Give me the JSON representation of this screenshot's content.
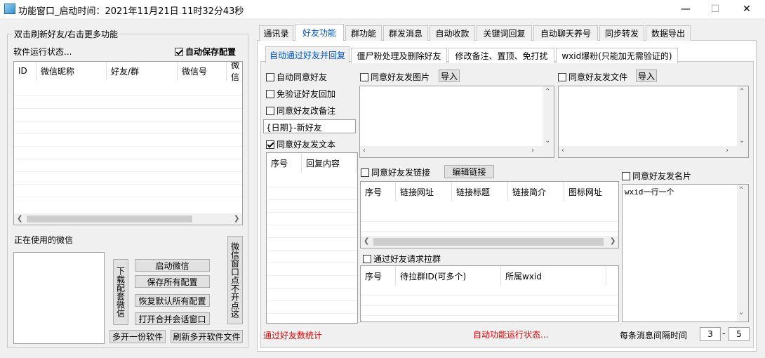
{
  "window": {
    "title": "功能窗口_启动时间：2021年11月21日 11时32分43秒",
    "min": "—",
    "max": "☐",
    "close": "✕"
  },
  "left": {
    "group_title": "双击刷新好友/右击更多功能",
    "status": "软件运行状态...",
    "auto_save": "自动保存配置",
    "columns": [
      "ID",
      "微信昵称",
      "好友/群",
      "微信号",
      "微信"
    ],
    "wechat_in_use": "正在使用的微信",
    "btn_download": "下载配套微信",
    "btn_start": "启动微信",
    "btn_save_all": "保存所有配置",
    "btn_restore": "恢复默认所有配置",
    "btn_open_merge": "打开合并会话窗口",
    "btn_window_no": "微信窗口点不开点这",
    "btn_multi": "多开一份软件",
    "btn_refresh_multi": "刷新多开软件文件"
  },
  "tabs": [
    "通讯录",
    "好友功能",
    "群功能",
    "群发消息",
    "自动收款",
    "关键词回复",
    "自动聊天养号",
    "同步转发",
    "数据导出"
  ],
  "subtabs": [
    "自动通过好友并回复",
    "僵尸粉处理及删除好友",
    "修改备注、置顶、免打扰",
    "wxid爆粉(只能加无需验证的)"
  ],
  "friend": {
    "auto_accept": "自动同意好友",
    "no_verify": "免验证好友回加",
    "change_remark": "同意好友改备注",
    "remark_value": "{日期}-新好友",
    "send_text": "同意好友发文本",
    "text_cols": [
      "序号",
      "回复内容"
    ],
    "send_image": "同意好友发图片",
    "import": "导入",
    "send_file": "同意好友发文件",
    "send_link": "同意好友发链接",
    "edit_link": "编辑链接",
    "link_cols": [
      "序号",
      "链接网址",
      "链接标题",
      "链接简介",
      "图标网址"
    ],
    "send_card": "同意好友发名片",
    "card_value": "wxid一行一个",
    "pull_group": "通过好友请求拉群",
    "group_cols": [
      "序号",
      "待拉群ID(可多个)",
      "所属wxid"
    ],
    "stat": "通过好友数统计",
    "run_status": "自动功能运行状态...",
    "interval_label": "每条消息间隔时间",
    "interval_min": "3",
    "dash": "-",
    "interval_max": "5"
  }
}
